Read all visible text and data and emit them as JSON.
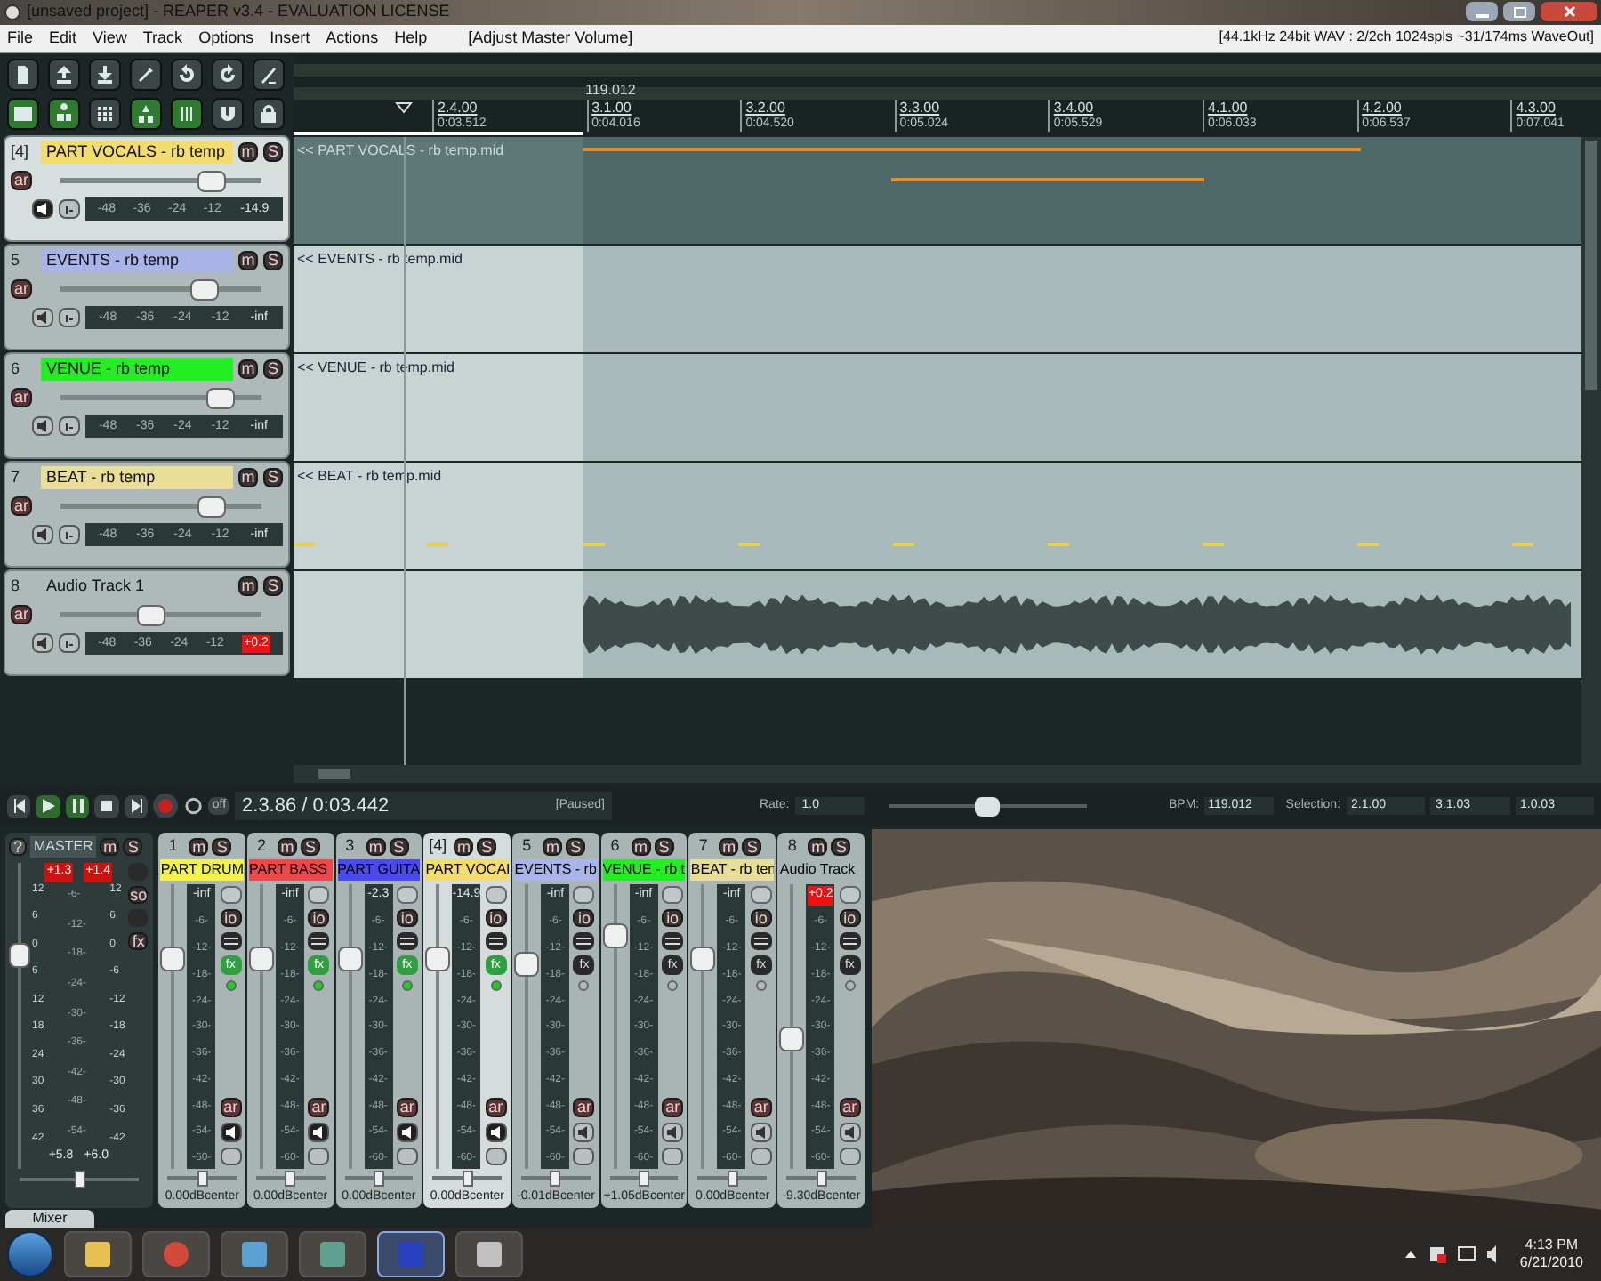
{
  "window": {
    "title": "[unsaved project] - REAPER v3.4 - EVALUATION LICENSE"
  },
  "menu": {
    "items": [
      "File",
      "Edit",
      "View",
      "Track",
      "Options",
      "Insert",
      "Actions",
      "Help"
    ],
    "action": "[Adjust Master Volume]",
    "audio_status": "[44.1kHz 24bit WAV : 2/2ch 1024spls ~31/174ms WaveOut]"
  },
  "toolbar": [
    {
      "on": false
    },
    {
      "on": false
    },
    {
      "on": false
    },
    {
      "on": false
    },
    {
      "on": false
    },
    {
      "on": false
    },
    {
      "on": false
    },
    {
      "on": true
    },
    {
      "on": true
    },
    {
      "on": false
    },
    {
      "on": true
    },
    {
      "on": true
    },
    {
      "on": false
    },
    {
      "on": false
    }
  ],
  "ruler": {
    "tempo": "119.012",
    "markers": [
      {
        "bar": "2.4.00",
        "time": "0:03.512"
      },
      {
        "bar": "3.1.00",
        "time": "0:04.016"
      },
      {
        "bar": "3.2.00",
        "time": "0:04.520"
      },
      {
        "bar": "3.3.00",
        "time": "0:05.024"
      },
      {
        "bar": "3.4.00",
        "time": "0:05.529"
      },
      {
        "bar": "4.1.00",
        "time": "0:06.033"
      },
      {
        "bar": "4.2.00",
        "time": "0:06.537"
      },
      {
        "bar": "4.3.00",
        "time": "0:07.041"
      }
    ]
  },
  "tracks": [
    {
      "number": "[4]",
      "name": "PART VOCALS - rb temp",
      "color": "#f2dc6e",
      "selected": true,
      "mute": "m",
      "solo": "S",
      "arm": "ar",
      "output_on": true,
      "level": 0.75,
      "scale": [
        "-48",
        "-36",
        "-24",
        "-12"
      ],
      "reading": "-14.9",
      "clip": false,
      "item": "<< PART VOCALS - rb temp.mid",
      "kind": "midi"
    },
    {
      "number": "5",
      "name": "EVENTS - rb temp",
      "color": "#a9b4e8",
      "selected": false,
      "mute": "m",
      "solo": "S",
      "arm": "ar",
      "output_on": false,
      "level": 0.72,
      "scale": [
        "-48",
        "-36",
        "-24",
        "-12"
      ],
      "reading": "-inf",
      "clip": false,
      "item": "<< EVENTS - rb temp.mid",
      "kind": "midi"
    },
    {
      "number": "6",
      "name": "VENUE - rb temp",
      "color": "#22ee22",
      "selected": false,
      "mute": "m",
      "solo": "S",
      "arm": "ar",
      "output_on": false,
      "level": 0.8,
      "scale": [
        "-48",
        "-36",
        "-24",
        "-12"
      ],
      "reading": "-inf",
      "clip": false,
      "item": "<< VENUE - rb temp.mid",
      "kind": "midi"
    },
    {
      "number": "7",
      "name": "BEAT - rb temp",
      "color": "#e8de98",
      "selected": false,
      "mute": "m",
      "solo": "S",
      "arm": "ar",
      "output_on": false,
      "level": 0.75,
      "scale": [
        "-48",
        "-36",
        "-24",
        "-12"
      ],
      "reading": "-inf",
      "clip": false,
      "item": "<< BEAT - rb temp.mid",
      "kind": "beat"
    },
    {
      "number": "8",
      "name": "Audio Track 1",
      "selected": false,
      "mute": "m",
      "solo": "S",
      "arm": "ar",
      "output_on": false,
      "level": 0.45,
      "scale": [
        "-48",
        "-36",
        "-24",
        "-12"
      ],
      "reading": "+0.2",
      "clip": true,
      "kind": "audio"
    }
  ],
  "transport": {
    "repeat": "off",
    "position": "2.3.86 / 0:03.442",
    "state": "[Paused]",
    "rate_label": "Rate:",
    "rate": "1.0",
    "rate_slider": {
      "level": 0.5
    },
    "bpm_label": "BPM:",
    "bpm": "119.012",
    "selection_label": "Selection:",
    "selection": [
      "2.1.00",
      "3.1.03",
      "1.0.03"
    ]
  },
  "mixer": {
    "tab": "Mixer",
    "master": {
      "help": "?",
      "name": "MASTER",
      "mute": "m",
      "solo": "S",
      "peaks": [
        "+1.3",
        "+1.4"
      ],
      "left_scale": [
        "12",
        "6",
        "0",
        "6",
        "12",
        "18",
        "24",
        "30",
        "36",
        "42"
      ],
      "mid_scale": [
        "-6-",
        "-12-",
        "-18-",
        "-24-",
        "-30-",
        "-36-",
        "-42-",
        "-48-",
        "-54-"
      ],
      "right_scale": [
        "12",
        "6",
        "0",
        "-6",
        "-12",
        "-18",
        "-24",
        "-30",
        "-36",
        "-42"
      ],
      "bottom": [
        "+5.8",
        "+6.0"
      ],
      "level": 0.7,
      "pan_slider": {
        "level": 0.5
      },
      "mono": "so",
      "fx": "fx"
    },
    "strips": [
      {
        "number": "1",
        "name": "PART DRUM",
        "color": "#f2f24a",
        "selected": false,
        "mute": "m",
        "solo": "S",
        "io": "io",
        "fx": "fx",
        "arm": "ar",
        "reading": "-inf",
        "clip": false,
        "scale": [
          "-6-",
          "-12-",
          "-18-",
          "-24-",
          "-30-",
          "-36-",
          "-42-",
          "-48-",
          "-54-",
          "-60-"
        ],
        "level": 0.74,
        "fx_on": true,
        "output_on": true,
        "pan_slider": {
          "level": 0.5
        },
        "pan": "0.00dBcenter"
      },
      {
        "number": "2",
        "name": "PART BASS",
        "color": "#f04848",
        "selected": false,
        "mute": "m",
        "solo": "S",
        "io": "io",
        "fx": "fx",
        "arm": "ar",
        "reading": "-inf",
        "clip": false,
        "scale": [
          "-6-",
          "-12-",
          "-18-",
          "-24-",
          "-30-",
          "-36-",
          "-42-",
          "-48-",
          "-54-",
          "-60-"
        ],
        "level": 0.74,
        "fx_on": true,
        "output_on": true,
        "pan_slider": {
          "level": 0.5
        },
        "pan": "0.00dBcenter"
      },
      {
        "number": "3",
        "name": "PART GUITA",
        "color": "#4a4af0",
        "selected": false,
        "mute": "m",
        "solo": "S",
        "io": "io",
        "fx": "fx",
        "arm": "ar",
        "reading": "-2.3",
        "clip": false,
        "scale": [
          "-6-",
          "-12-",
          "-18-",
          "-24-",
          "-30-",
          "-36-",
          "-42-",
          "-48-",
          "-54-",
          "-60-"
        ],
        "level": 0.74,
        "fx_on": true,
        "output_on": true,
        "pan_slider": {
          "level": 0.5
        },
        "pan": "0.00dBcenter"
      },
      {
        "number": "[4]",
        "name": "PART VOCAI",
        "color": "#f2dc6e",
        "selected": true,
        "mute": "m",
        "solo": "S",
        "io": "io",
        "fx": "fx",
        "arm": "ar",
        "reading": "-14.9",
        "clip": false,
        "scale": [
          "-6-",
          "-12-",
          "-18-",
          "-24-",
          "-30-",
          "-36-",
          "-42-",
          "-48-",
          "-54-",
          "-60-"
        ],
        "level": 0.74,
        "fx_on": true,
        "output_on": true,
        "pan_slider": {
          "level": 0.5
        },
        "pan": "0.00dBcenter"
      },
      {
        "number": "5",
        "name": "EVENTS - rb",
        "color": "#a9b4e8",
        "selected": false,
        "mute": "m",
        "solo": "S",
        "io": "io",
        "fx": "fx",
        "arm": "ar",
        "reading": "-inf",
        "clip": false,
        "scale": [
          "-6-",
          "-12-",
          "-18-",
          "-24-",
          "-30-",
          "-36-",
          "-42-",
          "-48-",
          "-54-",
          "-60-"
        ],
        "level": 0.72,
        "fx_on": false,
        "output_on": false,
        "pan_slider": {
          "level": 0.5
        },
        "pan": "-0.01dBcenter"
      },
      {
        "number": "6",
        "name": "VENUE - rb t",
        "color": "#22ee22",
        "selected": false,
        "mute": "m",
        "solo": "S",
        "io": "io",
        "fx": "fx",
        "arm": "ar",
        "reading": "-inf",
        "clip": false,
        "scale": [
          "-6-",
          "-12-",
          "-18-",
          "-24-",
          "-30-",
          "-36-",
          "-42-",
          "-48-",
          "-54-",
          "-60-"
        ],
        "level": 0.82,
        "fx_on": false,
        "output_on": false,
        "pan_slider": {
          "level": 0.5
        },
        "pan": "+1.05dBcenter"
      },
      {
        "number": "7",
        "name": "BEAT - rb ten",
        "color": "#e8de98",
        "selected": false,
        "mute": "m",
        "solo": "S",
        "io": "io",
        "fx": "fx",
        "arm": "ar",
        "reading": "-inf",
        "clip": false,
        "scale": [
          "-6-",
          "-12-",
          "-18-",
          "-24-",
          "-30-",
          "-36-",
          "-42-",
          "-48-",
          "-54-",
          "-60-"
        ],
        "level": 0.74,
        "fx_on": false,
        "output_on": false,
        "pan_slider": {
          "level": 0.5
        },
        "pan": "0.00dBcenter"
      },
      {
        "number": "8",
        "name": "Audio Track",
        "selected": false,
        "mute": "m",
        "solo": "S",
        "io": "io",
        "fx": "fx",
        "arm": "ar",
        "reading": "+0.2",
        "clip": true,
        "scale": [
          "-6-",
          "-12-",
          "-18-",
          "-24-",
          "-30-",
          "-36-",
          "-42-",
          "-48-",
          "-54-",
          "-60-"
        ],
        "level": 0.46,
        "fx_on": false,
        "output_on": false,
        "pan_slider": {
          "level": 0.5
        },
        "pan": "-9.30dBcenter"
      }
    ]
  },
  "taskbar": {
    "time": "4:13 PM",
    "date": "6/21/2010"
  }
}
